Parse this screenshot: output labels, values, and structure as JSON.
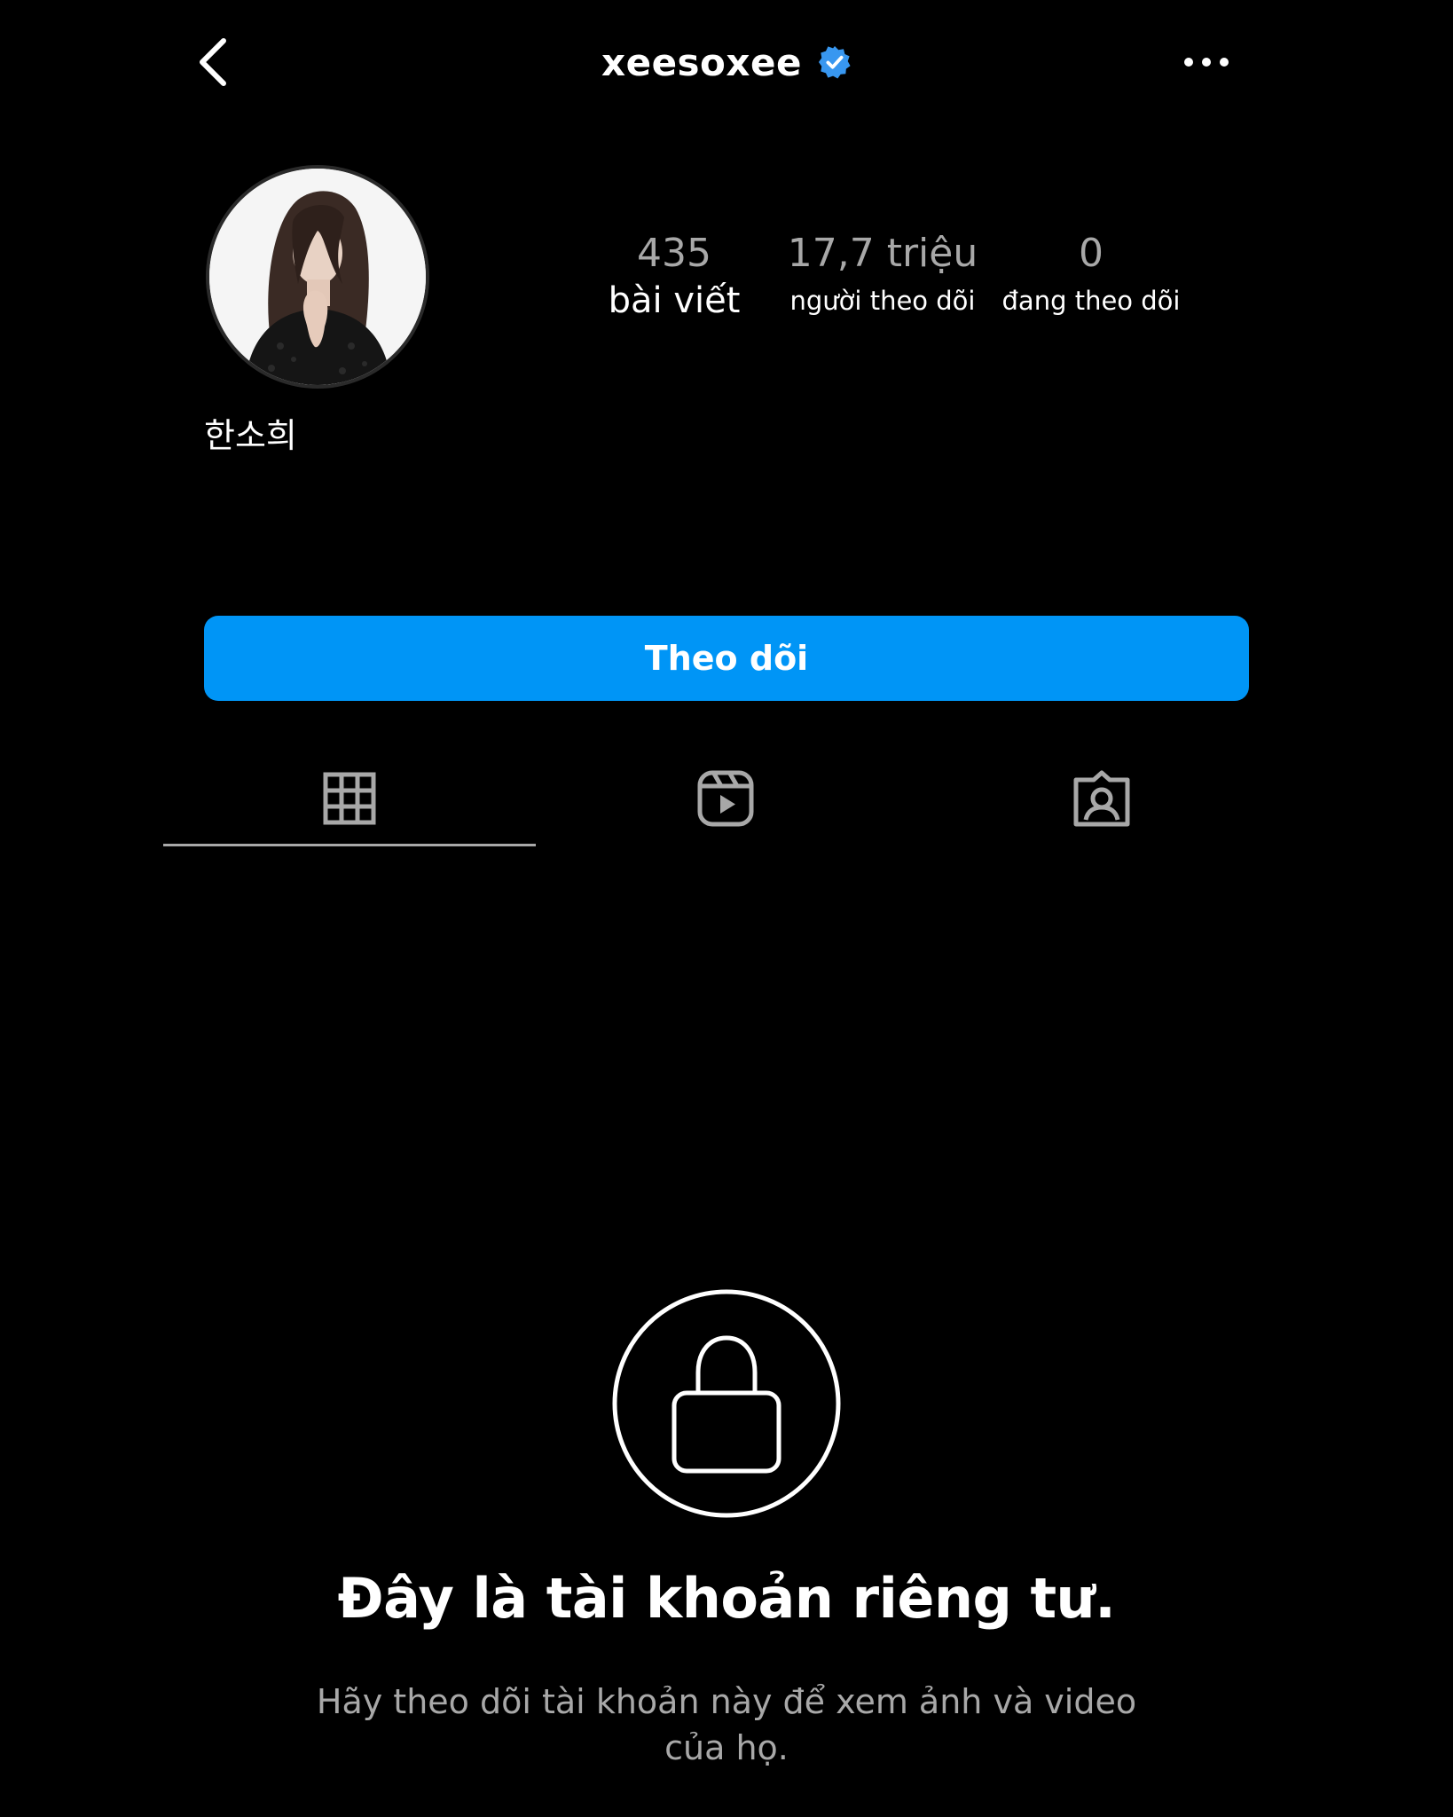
{
  "header": {
    "username": "xeesoxee",
    "verified": true,
    "back_icon": "chevron-left-icon",
    "more_icon": "more-horizontal-icon"
  },
  "profile": {
    "display_name": "한소희",
    "stats": {
      "posts_value": "435",
      "posts_label": "bài viết",
      "followers_value": "17,7 triệu",
      "followers_label": "người theo dõi",
      "following_value": "0",
      "following_label": "đang theo dõi"
    }
  },
  "follow_button": {
    "label": "Theo dõi",
    "color": "#0095f6"
  },
  "tabs": [
    {
      "icon": "grid-icon",
      "active": true
    },
    {
      "icon": "reels-icon",
      "active": false
    },
    {
      "icon": "tagged-icon",
      "active": false
    }
  ],
  "private_notice": {
    "icon": "lock-icon",
    "title": "Đây là tài khoản riêng tư.",
    "subtitle": "Hãy theo dõi tài khoản này để xem ảnh và video của họ."
  },
  "colors": {
    "background": "#000000",
    "text_primary": "#ffffff",
    "text_secondary": "#a8a8a8",
    "verified_badge": "#3897f0"
  }
}
